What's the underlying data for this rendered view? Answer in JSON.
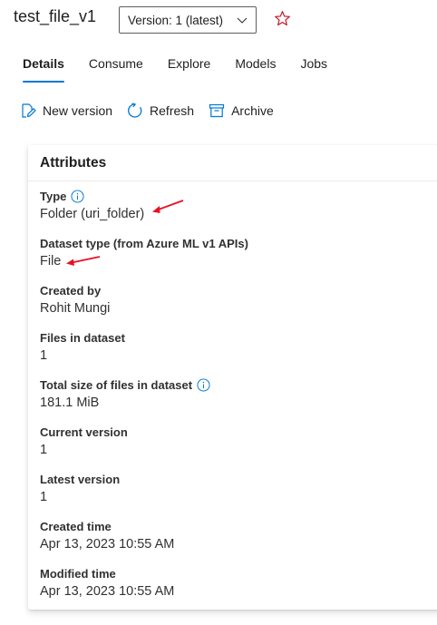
{
  "header": {
    "title": "test_file_v1",
    "version_select": "Version: 1 (latest)"
  },
  "tabs": [
    {
      "label": "Details",
      "active": true
    },
    {
      "label": "Consume",
      "active": false
    },
    {
      "label": "Explore",
      "active": false
    },
    {
      "label": "Models",
      "active": false
    },
    {
      "label": "Jobs",
      "active": false
    }
  ],
  "toolbar": {
    "new_version": "New version",
    "refresh": "Refresh",
    "archive": "Archive"
  },
  "attributes": {
    "heading": "Attributes",
    "items": [
      {
        "label": "Type",
        "value": "Folder (uri_folder)",
        "info": true
      },
      {
        "label": "Dataset type (from Azure ML v1 APIs)",
        "value": "File",
        "info": false
      },
      {
        "label": "Created by",
        "value": "Rohit Mungi",
        "info": false
      },
      {
        "label": "Files in dataset",
        "value": "1",
        "info": false
      },
      {
        "label": "Total size of files in dataset",
        "value": "181.1 MiB",
        "info": true
      },
      {
        "label": "Current version",
        "value": "1",
        "info": false
      },
      {
        "label": "Latest version",
        "value": "1",
        "info": false
      },
      {
        "label": "Created time",
        "value": "Apr 13, 2023 10:55 AM",
        "info": false
      },
      {
        "label": "Modified time",
        "value": "Apr 13, 2023 10:55 AM",
        "info": false
      }
    ]
  },
  "colors": {
    "accent": "#0078d4",
    "annotation_arrow": "#e81123",
    "star": "#c50f1f"
  },
  "icons": {
    "version_chevron": "chevron-down-icon",
    "favorite": "star-icon",
    "new_version": "edit-document-icon",
    "refresh": "refresh-icon",
    "archive": "archive-icon",
    "info": "info-icon"
  }
}
